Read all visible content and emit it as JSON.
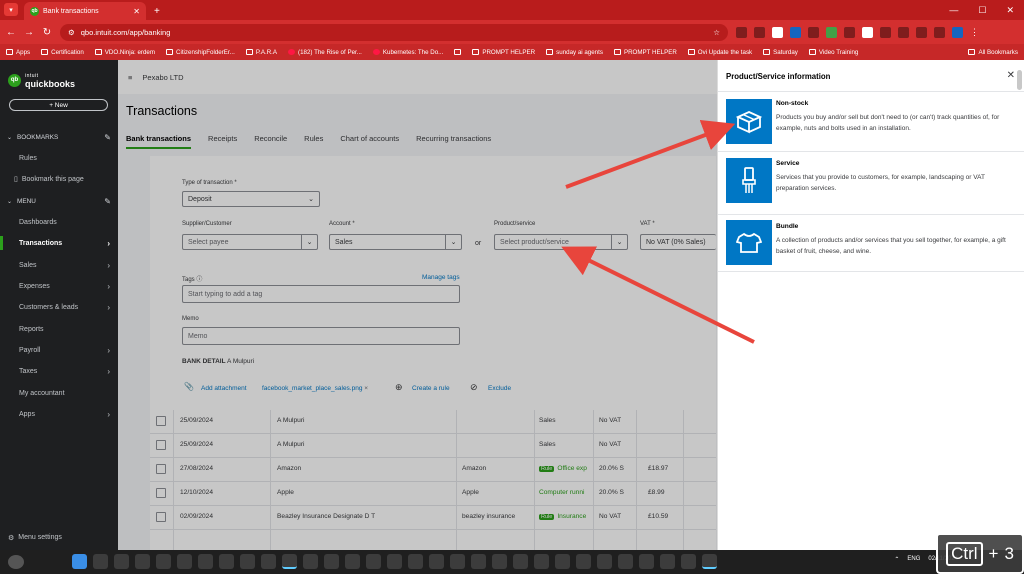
{
  "browser": {
    "tab_title": "Bank transactions",
    "url": "qbo.intuit.com/app/banking",
    "bookmarks": [
      "Apps",
      "Certification",
      "VDO.Ninja: erdem",
      "CitizenshipFolderEr...",
      "P.A.R.A",
      "(182) The Rise of Per...",
      "Kubernetes: The Do...",
      "",
      "PROMPT HELPER",
      "sunday ai agents",
      "PROMPT HELPER",
      "Ovi Update the task",
      "Saturday",
      "Video Training",
      "All Bookmarks"
    ]
  },
  "sidebar": {
    "logo_top": "intuit",
    "logo_bottom": "quickbooks",
    "new_label": "+ New",
    "bookmarks_header": "BOOKMARKS",
    "rules": "Rules",
    "bookmark_page": "Bookmark this page",
    "menu_header": "MENU",
    "items": [
      {
        "label": "Dashboards",
        "arrow": false
      },
      {
        "label": "Transactions",
        "arrow": true,
        "active": true
      },
      {
        "label": "Sales",
        "arrow": true
      },
      {
        "label": "Expenses",
        "arrow": true
      },
      {
        "label": "Customers & leads",
        "arrow": true
      },
      {
        "label": "Reports",
        "arrow": false
      },
      {
        "label": "Payroll",
        "arrow": true
      },
      {
        "label": "Taxes",
        "arrow": true
      },
      {
        "label": "My accountant",
        "arrow": false
      },
      {
        "label": "Apps",
        "arrow": true
      }
    ],
    "menu_settings": "Menu settings"
  },
  "main": {
    "company": "Pexabo LTD",
    "title": "Transactions",
    "tabs": [
      "Bank transactions",
      "Receipts",
      "Reconcile",
      "Rules",
      "Chart of accounts",
      "Recurring transactions"
    ]
  },
  "form": {
    "type_label": "Type of transaction *",
    "type_value": "Deposit",
    "supplier_label": "Supplier/Customer",
    "supplier_placeholder": "Select payee",
    "account_label": "Account *",
    "account_value": "Sales",
    "or": "or",
    "product_label": "Product/service",
    "product_placeholder": "Select product/service",
    "vat_label": "VAT *",
    "vat_value": "No VAT (0% Sales)",
    "tags_label": "Tags",
    "manage_tags": "Manage tags",
    "tags_placeholder": "Start typing to add a tag",
    "memo_label": "Memo",
    "memo_placeholder": "Memo",
    "bank_detail": "BANK DETAIL",
    "bank_detail_value": "A Mulpuri",
    "add_attachment": "Add attachment",
    "attachment_file": "facebook_market_place_sales.png",
    "create_rule": "Create a rule",
    "exclude": "Exclude"
  },
  "rows": [
    {
      "date": "25/09/2024",
      "desc": "A Mulpuri",
      "payee": "",
      "rule": "",
      "cat": "Sales",
      "vat": "No VAT",
      "amt": ""
    },
    {
      "date": "25/09/2024",
      "desc": "A Mulpuri",
      "payee": "",
      "rule": "",
      "cat": "Sales",
      "vat": "No VAT",
      "amt": ""
    },
    {
      "date": "27/08/2024",
      "desc": "Amazon",
      "payee": "Amazon",
      "rule": "Rule",
      "cat": "Office exp",
      "vat": "20.0% S",
      "amt": "£18.97"
    },
    {
      "date": "12/10/2024",
      "desc": "Apple",
      "payee": "Apple",
      "rule": "",
      "cat": "Computer runni",
      "vat": "20.0% S",
      "amt": "£8.99"
    },
    {
      "date": "02/09/2024",
      "desc": "Beazley Insurance Designate D T",
      "payee": "beazley insurance",
      "rule": "Rule",
      "cat": "Insurance",
      "vat": "No VAT",
      "amt": "£10.59"
    }
  ],
  "panel": {
    "title": "Product/Service information",
    "options": [
      {
        "name": "Non-stock",
        "desc": "Products you buy and/or sell but don't need to (or can't) track quantities of, for example, nuts and bolts used in an installation."
      },
      {
        "name": "Service",
        "desc": "Services that you provide to customers, for example, landscaping or VAT preparation services."
      },
      {
        "name": "Bundle",
        "desc": "A collection of products and/or services that you sell together, for example, a gift basket of fruit, cheese, and wine."
      }
    ]
  },
  "taskbar": {
    "lang": "ENG",
    "date": "02/11/2024"
  },
  "key_overlay": {
    "key": "Ctrl",
    "plus": "+",
    "count": "3"
  },
  "colors": {
    "accent": "#2ca01c",
    "link": "#0077c5",
    "arrow": "#e8453c",
    "chrome": "#d32f2f"
  }
}
